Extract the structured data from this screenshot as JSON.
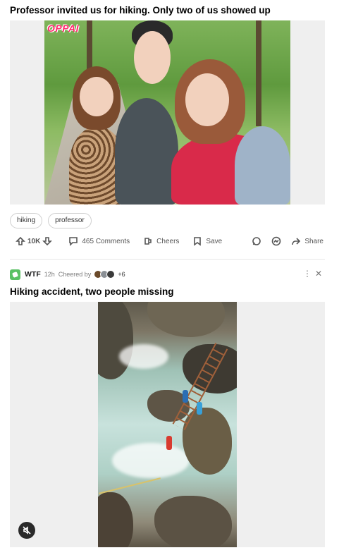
{
  "post1": {
    "title": "Professor invited us for hiking. Only two of us showed up",
    "watermark": "OPPAI",
    "tags": [
      "hiking",
      "professor"
    ],
    "votes": "10K",
    "comments": "465 Comments",
    "cheers": "Cheers",
    "save": "Save",
    "share": "Share"
  },
  "post2": {
    "community": "WTF",
    "age": "12h",
    "cheered_by_label": "Cheered by",
    "cheered_count": "+6",
    "title": "Hiking accident, two people missing"
  },
  "colors": {
    "community_icon": "#5ac165",
    "watermark": "#ff2a6d"
  }
}
